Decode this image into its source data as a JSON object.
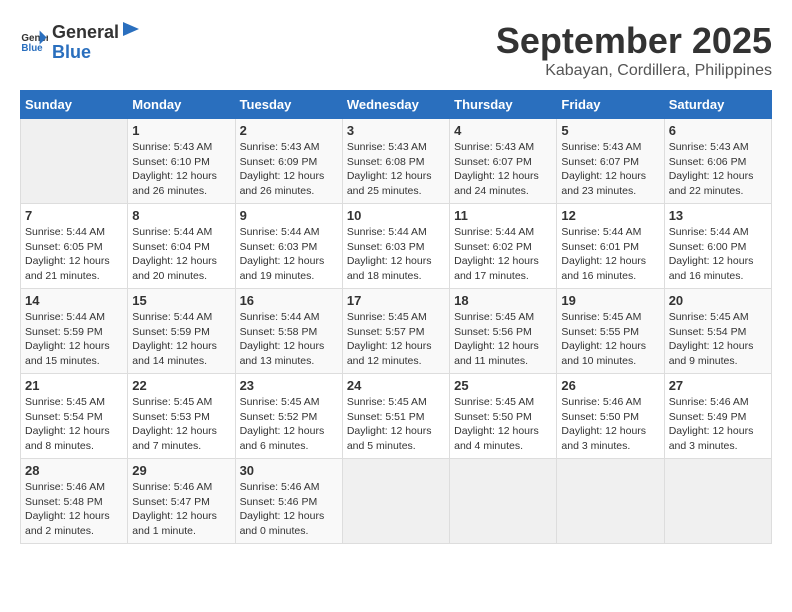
{
  "header": {
    "logo_general": "General",
    "logo_blue": "Blue",
    "month": "September 2025",
    "location": "Kabayan, Cordillera, Philippines"
  },
  "weekdays": [
    "Sunday",
    "Monday",
    "Tuesday",
    "Wednesday",
    "Thursday",
    "Friday",
    "Saturday"
  ],
  "weeks": [
    [
      {
        "day": "",
        "info": ""
      },
      {
        "day": "1",
        "info": "Sunrise: 5:43 AM\nSunset: 6:10 PM\nDaylight: 12 hours\nand 26 minutes."
      },
      {
        "day": "2",
        "info": "Sunrise: 5:43 AM\nSunset: 6:09 PM\nDaylight: 12 hours\nand 26 minutes."
      },
      {
        "day": "3",
        "info": "Sunrise: 5:43 AM\nSunset: 6:08 PM\nDaylight: 12 hours\nand 25 minutes."
      },
      {
        "day": "4",
        "info": "Sunrise: 5:43 AM\nSunset: 6:07 PM\nDaylight: 12 hours\nand 24 minutes."
      },
      {
        "day": "5",
        "info": "Sunrise: 5:43 AM\nSunset: 6:07 PM\nDaylight: 12 hours\nand 23 minutes."
      },
      {
        "day": "6",
        "info": "Sunrise: 5:43 AM\nSunset: 6:06 PM\nDaylight: 12 hours\nand 22 minutes."
      }
    ],
    [
      {
        "day": "7",
        "info": "Sunrise: 5:44 AM\nSunset: 6:05 PM\nDaylight: 12 hours\nand 21 minutes."
      },
      {
        "day": "8",
        "info": "Sunrise: 5:44 AM\nSunset: 6:04 PM\nDaylight: 12 hours\nand 20 minutes."
      },
      {
        "day": "9",
        "info": "Sunrise: 5:44 AM\nSunset: 6:03 PM\nDaylight: 12 hours\nand 19 minutes."
      },
      {
        "day": "10",
        "info": "Sunrise: 5:44 AM\nSunset: 6:03 PM\nDaylight: 12 hours\nand 18 minutes."
      },
      {
        "day": "11",
        "info": "Sunrise: 5:44 AM\nSunset: 6:02 PM\nDaylight: 12 hours\nand 17 minutes."
      },
      {
        "day": "12",
        "info": "Sunrise: 5:44 AM\nSunset: 6:01 PM\nDaylight: 12 hours\nand 16 minutes."
      },
      {
        "day": "13",
        "info": "Sunrise: 5:44 AM\nSunset: 6:00 PM\nDaylight: 12 hours\nand 16 minutes."
      }
    ],
    [
      {
        "day": "14",
        "info": "Sunrise: 5:44 AM\nSunset: 5:59 PM\nDaylight: 12 hours\nand 15 minutes."
      },
      {
        "day": "15",
        "info": "Sunrise: 5:44 AM\nSunset: 5:59 PM\nDaylight: 12 hours\nand 14 minutes."
      },
      {
        "day": "16",
        "info": "Sunrise: 5:44 AM\nSunset: 5:58 PM\nDaylight: 12 hours\nand 13 minutes."
      },
      {
        "day": "17",
        "info": "Sunrise: 5:45 AM\nSunset: 5:57 PM\nDaylight: 12 hours\nand 12 minutes."
      },
      {
        "day": "18",
        "info": "Sunrise: 5:45 AM\nSunset: 5:56 PM\nDaylight: 12 hours\nand 11 minutes."
      },
      {
        "day": "19",
        "info": "Sunrise: 5:45 AM\nSunset: 5:55 PM\nDaylight: 12 hours\nand 10 minutes."
      },
      {
        "day": "20",
        "info": "Sunrise: 5:45 AM\nSunset: 5:54 PM\nDaylight: 12 hours\nand 9 minutes."
      }
    ],
    [
      {
        "day": "21",
        "info": "Sunrise: 5:45 AM\nSunset: 5:54 PM\nDaylight: 12 hours\nand 8 minutes."
      },
      {
        "day": "22",
        "info": "Sunrise: 5:45 AM\nSunset: 5:53 PM\nDaylight: 12 hours\nand 7 minutes."
      },
      {
        "day": "23",
        "info": "Sunrise: 5:45 AM\nSunset: 5:52 PM\nDaylight: 12 hours\nand 6 minutes."
      },
      {
        "day": "24",
        "info": "Sunrise: 5:45 AM\nSunset: 5:51 PM\nDaylight: 12 hours\nand 5 minutes."
      },
      {
        "day": "25",
        "info": "Sunrise: 5:45 AM\nSunset: 5:50 PM\nDaylight: 12 hours\nand 4 minutes."
      },
      {
        "day": "26",
        "info": "Sunrise: 5:46 AM\nSunset: 5:50 PM\nDaylight: 12 hours\nand 3 minutes."
      },
      {
        "day": "27",
        "info": "Sunrise: 5:46 AM\nSunset: 5:49 PM\nDaylight: 12 hours\nand 3 minutes."
      }
    ],
    [
      {
        "day": "28",
        "info": "Sunrise: 5:46 AM\nSunset: 5:48 PM\nDaylight: 12 hours\nand 2 minutes."
      },
      {
        "day": "29",
        "info": "Sunrise: 5:46 AM\nSunset: 5:47 PM\nDaylight: 12 hours\nand 1 minute."
      },
      {
        "day": "30",
        "info": "Sunrise: 5:46 AM\nSunset: 5:46 PM\nDaylight: 12 hours\nand 0 minutes."
      },
      {
        "day": "",
        "info": ""
      },
      {
        "day": "",
        "info": ""
      },
      {
        "day": "",
        "info": ""
      },
      {
        "day": "",
        "info": ""
      }
    ]
  ]
}
